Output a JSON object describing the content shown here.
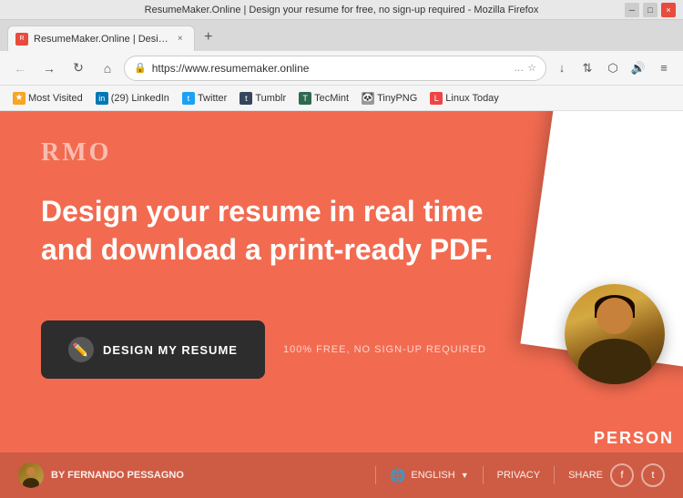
{
  "window": {
    "title": "ResumeMaker.Online | Design your resume for free, no sign-up required - Mozilla Firefox"
  },
  "tab": {
    "favicon_label": "R",
    "title": "ResumeMaker.Online | Desi…",
    "close_label": "×"
  },
  "new_tab_button_label": "+",
  "nav": {
    "back_label": "←",
    "forward_label": "→",
    "refresh_label": "↻",
    "home_label": "⌂",
    "url": "https://www.resumemaker.online",
    "more_label": "…",
    "bookmark_label": "☆",
    "download_label": "↓",
    "sync_label": "⇅",
    "extensions_label": "🧩",
    "speaker_label": "🔊",
    "menu_label": "≡"
  },
  "bookmarks": [
    {
      "id": "most-visited",
      "icon_label": "★",
      "icon_color": "#f5a623",
      "label": "Most Visited"
    },
    {
      "id": "linkedin",
      "icon_label": "in",
      "icon_color": "#0077b5",
      "label": "(29) LinkedIn"
    },
    {
      "id": "twitter",
      "icon_label": "t",
      "icon_color": "#1da1f2",
      "label": "Twitter"
    },
    {
      "id": "tumblr",
      "icon_label": "t",
      "icon_color": "#35465c",
      "label": "Tumblr"
    },
    {
      "id": "tecmint",
      "icon_label": "T",
      "icon_color": "#2d6a4f",
      "label": "TecMint"
    },
    {
      "id": "tinypng",
      "icon_label": "🐼",
      "icon_color": "#aaa",
      "label": "TinyPNG"
    },
    {
      "id": "linuxtoday",
      "icon_label": "L",
      "icon_color": "#e44",
      "label": "Linux Today"
    }
  ],
  "hero": {
    "logo": "RMO",
    "title_line1": "Design your resume in real time",
    "title_line2": "and download a print-ready PDF.",
    "cta_label": "DESIGN MY RESUME",
    "cta_sublabel": "100% FREE, NO SIGN-UP REQUIRED"
  },
  "footer": {
    "author_label": "BY FERNANDO PESSAGNO",
    "lang_label": "ENGLISH",
    "privacy_label": "PRIVACY",
    "share_label": "SHARE",
    "facebook_label": "f",
    "twitter_label": "t"
  },
  "colors": {
    "page_bg": "#f26b50",
    "cta_bg": "#2d2d2d",
    "footer_bg": "rgba(0,0,0,0.15)"
  }
}
